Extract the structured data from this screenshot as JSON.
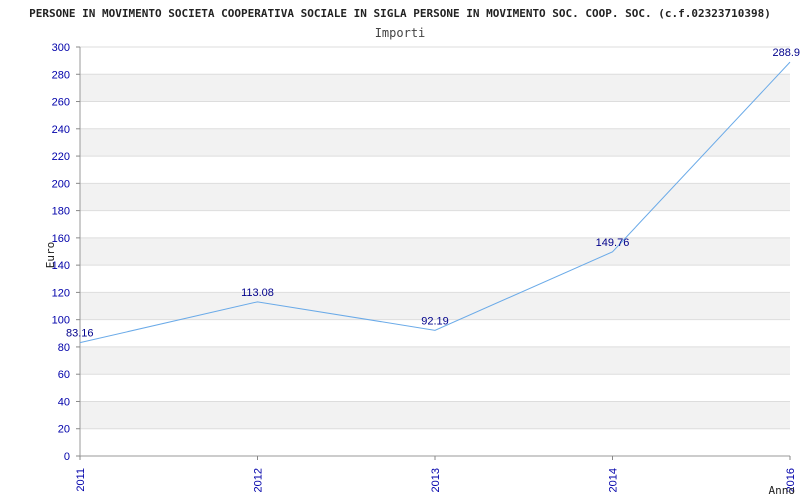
{
  "chart_data": {
    "type": "line",
    "title": "PERSONE IN MOVIMENTO SOCIETA COOPERATIVA SOCIALE IN SIGLA PERSONE IN MOVIMENTO SOC. COOP. SOC. (c.f.02323710398)",
    "subtitle": "Importi",
    "xlabel": "Anno",
    "ylabel": "Euro",
    "categories": [
      "2011",
      "2012",
      "2013",
      "2014",
      "2016"
    ],
    "values": [
      83.16,
      113.08,
      92.19,
      149.76,
      288.9
    ],
    "value_labels": [
      "83.16",
      "113.08",
      "92.19",
      "149.76",
      "288.9"
    ],
    "ylim": [
      0,
      300
    ],
    "yticks": [
      0,
      20,
      40,
      60,
      80,
      100,
      120,
      140,
      160,
      180,
      200,
      220,
      240,
      260,
      280,
      300
    ],
    "grid": true,
    "colors": {
      "line": "#6aaae8",
      "band": "#f2f2f2",
      "gridline": "#dddddd",
      "tick_text": "#0000aa",
      "data_label": "#00008b"
    }
  }
}
